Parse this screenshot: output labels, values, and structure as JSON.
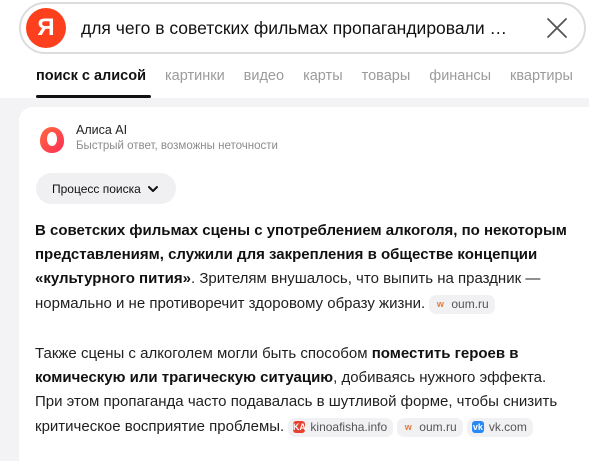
{
  "search": {
    "logo_letter": "Я",
    "query": "для чего в советских фильмах пропагандировали …"
  },
  "tabs": [
    {
      "label": "поиск с алисой",
      "active": true
    },
    {
      "label": "картинки"
    },
    {
      "label": "видео"
    },
    {
      "label": "карты"
    },
    {
      "label": "товары"
    },
    {
      "label": "финансы"
    },
    {
      "label": "квартиры"
    }
  ],
  "answer": {
    "name": "Алиса AI",
    "subtitle": "Быстрый ответ, возможны неточности",
    "process_label": "Процесс поиска",
    "p1_bold": "В советских фильмах сцены с употреблением алкоголя, по некоторым представлениям, служили для закрепления в обществе концепции «культурного пития»",
    "p1_rest": ". Зрителям внушалось, что выпить на праздник — нормально и не противоречит здоровому образу жизни.",
    "p1_source": "oum.ru",
    "p2_start": "Также сцены с алкоголем могли быть способом ",
    "p2_bold": "поместить героев в комическую или трагическую ситуацию",
    "p2_rest": ", добиваясь нужного эффекта. При этом пропаганда часто подавалась в шутливой форме, чтобы снизить критическое восприятие проблемы.",
    "p2_sources": [
      "kinoafisha.info",
      "oum.ru",
      "vk.com"
    ]
  },
  "colors": {
    "yandex_red": "#fc3f1d",
    "alice_gradient": [
      "#ff5a36",
      "#ff2d55"
    ]
  },
  "icons": {
    "clear": "close-icon",
    "chevron": "chevron-down-icon"
  }
}
